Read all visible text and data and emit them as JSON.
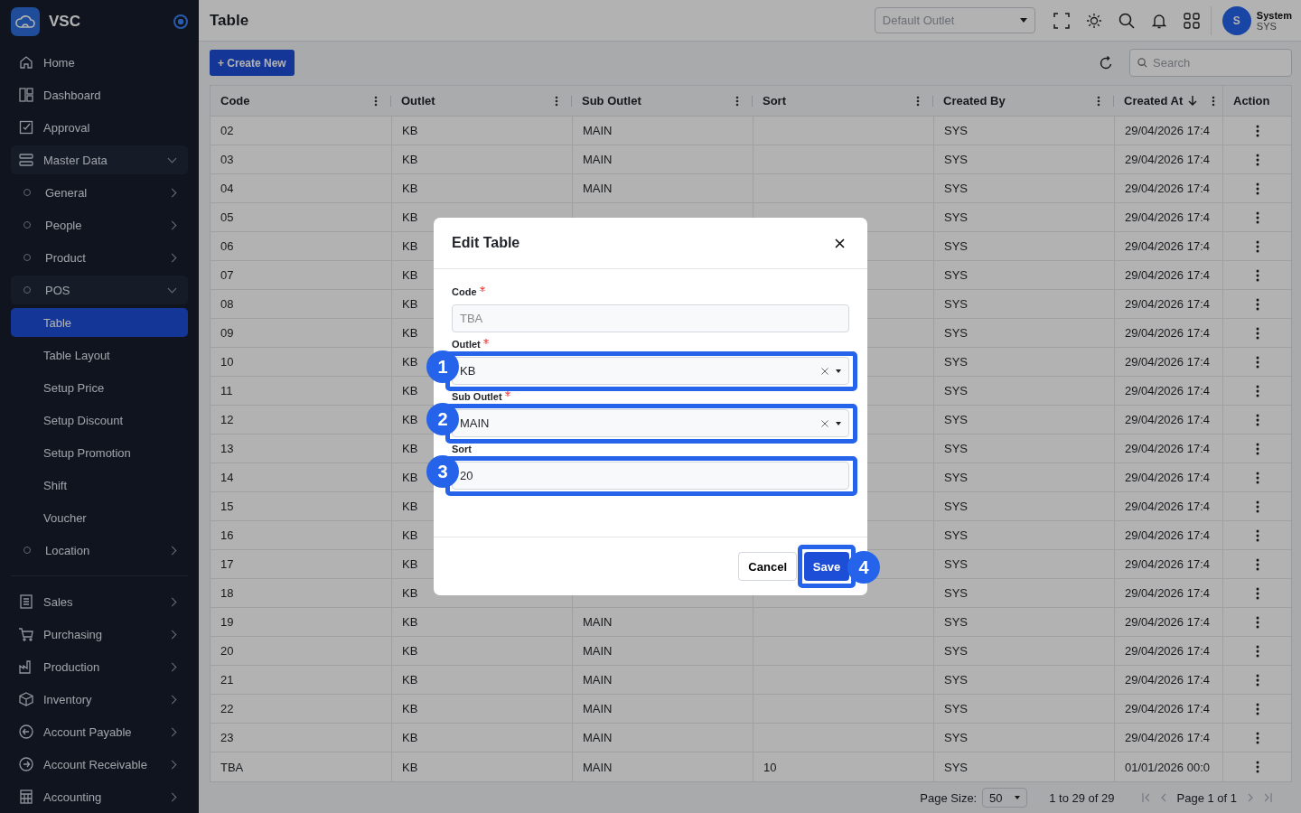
{
  "brand": {
    "name": "VSC"
  },
  "sidebar": {
    "items": [
      {
        "label": "Home",
        "kind": "link",
        "selected": false
      },
      {
        "label": "Dashboard",
        "kind": "link",
        "selected": false
      },
      {
        "label": "Approval",
        "kind": "link",
        "selected": false
      },
      {
        "label": "Master Data",
        "kind": "section",
        "selected": false,
        "expanded": true,
        "children": [
          {
            "label": "General",
            "kind": "group",
            "selected": false,
            "expanded": false
          },
          {
            "label": "People",
            "kind": "group",
            "selected": false,
            "expanded": false
          },
          {
            "label": "Product",
            "kind": "group",
            "selected": false,
            "expanded": false
          },
          {
            "label": "POS",
            "kind": "group",
            "selected": false,
            "expanded": true,
            "children": [
              {
                "label": "Table",
                "kind": "leaf",
                "selected": true
              },
              {
                "label": "Table Layout",
                "kind": "leaf",
                "selected": false
              },
              {
                "label": "Setup Price",
                "kind": "leaf",
                "selected": false
              },
              {
                "label": "Setup Discount",
                "kind": "leaf",
                "selected": false
              },
              {
                "label": "Setup Promotion",
                "kind": "leaf",
                "selected": false
              },
              {
                "label": "Shift",
                "kind": "leaf",
                "selected": false
              },
              {
                "label": "Voucher",
                "kind": "leaf",
                "selected": false
              }
            ]
          },
          {
            "label": "Location",
            "kind": "group",
            "selected": false,
            "expanded": false
          }
        ]
      },
      {
        "label": "Sales",
        "kind": "section",
        "selected": false,
        "expanded": false
      },
      {
        "label": "Purchasing",
        "kind": "section",
        "selected": false,
        "expanded": false
      },
      {
        "label": "Production",
        "kind": "section",
        "selected": false,
        "expanded": false
      },
      {
        "label": "Inventory",
        "kind": "section",
        "selected": false,
        "expanded": false
      },
      {
        "label": "Account Payable",
        "kind": "section",
        "selected": false,
        "expanded": false
      },
      {
        "label": "Account Receivable",
        "kind": "section",
        "selected": false,
        "expanded": false
      },
      {
        "label": "Accounting",
        "kind": "section",
        "selected": false,
        "expanded": false
      }
    ]
  },
  "header": {
    "title": "Table",
    "outlet_select": {
      "placeholder": "Default Outlet"
    },
    "user": {
      "initial": "S",
      "name": "System",
      "code": "SYS"
    }
  },
  "toolbar": {
    "create_button": "+ Create New",
    "search": {
      "placeholder": "Search"
    }
  },
  "table": {
    "columns": [
      {
        "label": "Code"
      },
      {
        "label": "Outlet"
      },
      {
        "label": "Sub Outlet"
      },
      {
        "label": "Sort"
      },
      {
        "label": "Created By"
      },
      {
        "label": "Created At",
        "sorted": true
      },
      {
        "label": "Action"
      }
    ],
    "rows": [
      {
        "code": "02",
        "outlet": "KB",
        "sub_outlet": "MAIN",
        "created_by": "SYS",
        "created_at": "29/04/2026 17:4"
      },
      {
        "code": "03",
        "outlet": "KB",
        "sub_outlet": "MAIN",
        "created_by": "SYS",
        "created_at": "29/04/2026 17:4"
      },
      {
        "code": "04",
        "outlet": "KB",
        "sub_outlet": "MAIN",
        "created_by": "SYS",
        "created_at": "29/04/2026 17:4"
      },
      {
        "code": "05",
        "outlet": "KB",
        "created_by": "SYS",
        "created_at": "29/04/2026 17:4"
      },
      {
        "code": "06",
        "outlet": "KB",
        "created_by": "SYS",
        "created_at": "29/04/2026 17:4"
      },
      {
        "code": "07",
        "outlet": "KB",
        "created_by": "SYS",
        "created_at": "29/04/2026 17:4"
      },
      {
        "code": "08",
        "outlet": "KB",
        "created_by": "SYS",
        "created_at": "29/04/2026 17:4"
      },
      {
        "code": "09",
        "outlet": "KB",
        "created_by": "SYS",
        "created_at": "29/04/2026 17:4"
      },
      {
        "code": "10",
        "outlet": "KB",
        "created_by": "SYS",
        "created_at": "29/04/2026 17:4"
      },
      {
        "code": "11",
        "outlet": "KB",
        "created_by": "SYS",
        "created_at": "29/04/2026 17:4"
      },
      {
        "code": "12",
        "outlet": "KB",
        "created_by": "SYS",
        "created_at": "29/04/2026 17:4"
      },
      {
        "code": "13",
        "outlet": "KB",
        "created_by": "SYS",
        "created_at": "29/04/2026 17:4"
      },
      {
        "code": "14",
        "outlet": "KB",
        "created_by": "SYS",
        "created_at": "29/04/2026 17:4"
      },
      {
        "code": "15",
        "outlet": "KB",
        "created_by": "SYS",
        "created_at": "29/04/2026 17:4"
      },
      {
        "code": "16",
        "outlet": "KB",
        "created_by": "SYS",
        "created_at": "29/04/2026 17:4"
      },
      {
        "code": "17",
        "outlet": "KB",
        "created_by": "SYS",
        "created_at": "29/04/2026 17:4"
      },
      {
        "code": "18",
        "outlet": "KB",
        "created_by": "SYS",
        "created_at": "29/04/2026 17:4"
      },
      {
        "code": "19",
        "outlet": "KB",
        "sub_outlet": "MAIN",
        "created_by": "SYS",
        "created_at": "29/04/2026 17:4"
      },
      {
        "code": "20",
        "outlet": "KB",
        "sub_outlet": "MAIN",
        "created_by": "SYS",
        "created_at": "29/04/2026 17:4"
      },
      {
        "code": "21",
        "outlet": "KB",
        "sub_outlet": "MAIN",
        "created_by": "SYS",
        "created_at": "29/04/2026 17:4"
      },
      {
        "code": "22",
        "outlet": "KB",
        "sub_outlet": "MAIN",
        "created_by": "SYS",
        "created_at": "29/04/2026 17:4"
      },
      {
        "code": "23",
        "outlet": "KB",
        "sub_outlet": "MAIN",
        "created_by": "SYS",
        "created_at": "29/04/2026 17:4"
      },
      {
        "code": "TBA",
        "outlet": "KB",
        "sub_outlet": "MAIN",
        "sort": "10",
        "created_by": "SYS",
        "created_at": "01/01/2026 00:0"
      }
    ]
  },
  "pagination": {
    "page_size_label": "Page Size:",
    "page_size": "50",
    "range": "1 to 29 of 29",
    "page": "Page 1 of 1"
  },
  "modal": {
    "title": "Edit Table",
    "fields": [
      {
        "label": "Code",
        "kind": "text",
        "required": true,
        "value": "TBA",
        "disabled": true
      },
      {
        "label": "Outlet",
        "kind": "select",
        "required": true,
        "value": "KB",
        "disabled": false,
        "step": "1"
      },
      {
        "label": "Sub Outlet",
        "kind": "select",
        "required": true,
        "value": "MAIN",
        "disabled": false,
        "step": "2"
      },
      {
        "label": "Sort",
        "kind": "text",
        "required": false,
        "value": "20",
        "disabled": false,
        "step": "3"
      }
    ],
    "cancel_button": "Cancel",
    "save_button": {
      "label": "Save",
      "step": "4"
    }
  }
}
